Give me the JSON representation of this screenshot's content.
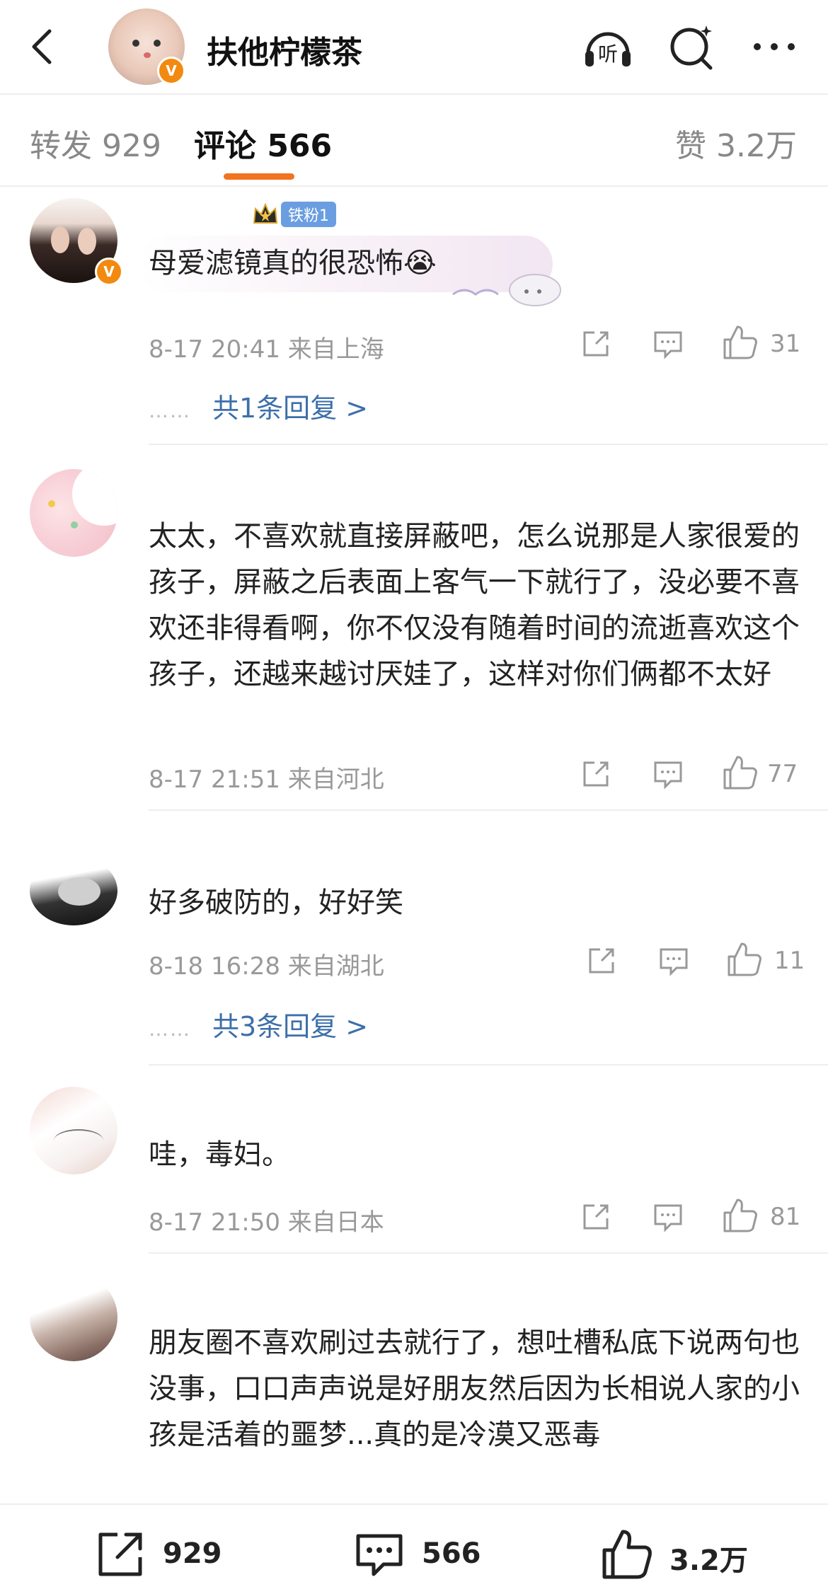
{
  "header": {
    "title": "扶他柠檬茶",
    "verified_badge": "V",
    "icons": [
      "back-icon",
      "listen-icon",
      "search-icon",
      "more-icon"
    ],
    "listen_label": "听"
  },
  "tabs": {
    "repost": "转发 929",
    "comment": "评论 566",
    "like": "赞 3.2万"
  },
  "accent_color": "#f27320",
  "link_color": "#3d6faa",
  "comments": [
    {
      "fan_badge": "铁粉1",
      "text": "母爱滤镜真的很恐怖😭",
      "meta": "8-17 20:41 来自上海",
      "likes": "31",
      "replies": "共1条回复 >"
    },
    {
      "text": "太太，不喜欢就直接屏蔽吧，怎么说那是人家很爱的孩子，屏蔽之后表面上客气一下就行了，没必要不喜欢还非得看啊，你不仅没有随着时间的流逝喜欢这个孩子，还越来越讨厌娃了，这样对你们俩都不太好",
      "meta": "8-17 21:51 来自河北",
      "likes": "77"
    },
    {
      "text": "好多破防的，好好笑",
      "meta": "8-18 16:28 来自湖北",
      "likes": "11",
      "replies": "共3条回复 >"
    },
    {
      "text": "哇，毒妇。",
      "meta": "8-17 21:50 来自日本",
      "likes": "81"
    },
    {
      "text": "朋友圈不喜欢刷过去就行了，想吐槽私底下说两句也没事，口口声声说是好朋友然后因为长相说人家的小孩是活着的噩梦...真的是冷漠又恶毒"
    }
  ],
  "footer": {
    "repost_count": "929",
    "comment_count": "566",
    "like_count": "3.2万"
  }
}
